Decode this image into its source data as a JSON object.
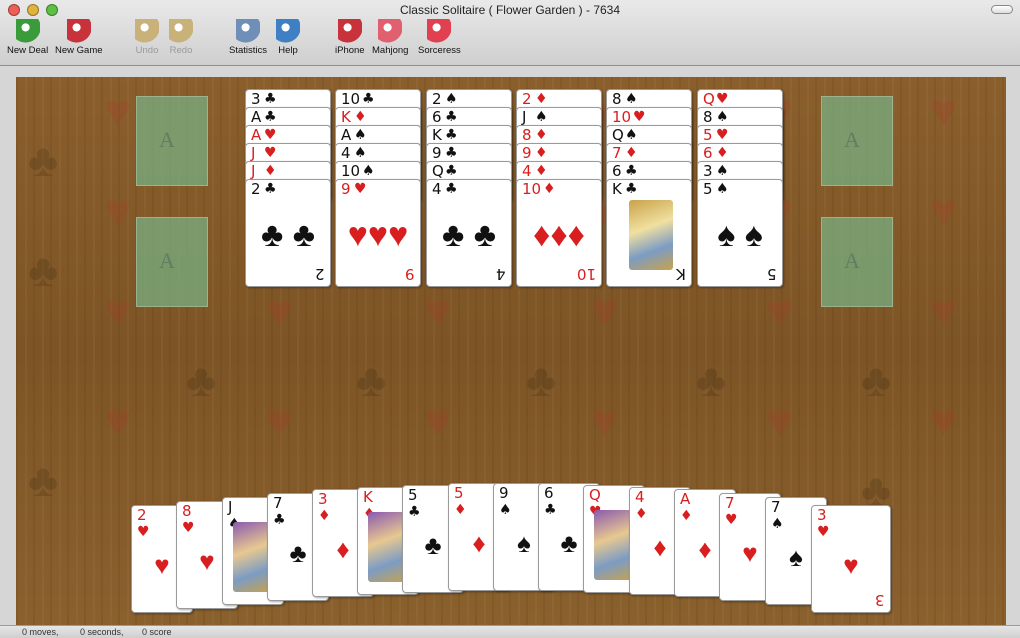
{
  "window": {
    "title": "Classic Solitaire ( Flower Garden ) - 7634"
  },
  "toolbar": [
    {
      "label": "New Deal",
      "icon": "new-deal-icon",
      "enabled": true
    },
    {
      "label": "New Game",
      "icon": "new-game-icon",
      "enabled": true
    },
    {
      "label": "Undo",
      "icon": "undo-icon",
      "enabled": false
    },
    {
      "label": "Redo",
      "icon": "redo-icon",
      "enabled": false
    },
    {
      "label": "Statistics",
      "icon": "statistics-icon",
      "enabled": true
    },
    {
      "label": "Help",
      "icon": "help-icon",
      "enabled": true
    },
    {
      "label": "iPhone",
      "icon": "iphone-icon",
      "enabled": true
    },
    {
      "label": "Mahjong",
      "icon": "mahjong-icon",
      "enabled": true
    },
    {
      "label": "Sorceress",
      "icon": "sorceress-icon",
      "enabled": true
    }
  ],
  "foundations": [
    {
      "label": "A"
    },
    {
      "label": "A"
    },
    {
      "label": "A"
    },
    {
      "label": "A"
    }
  ],
  "tableau": [
    {
      "cards": [
        [
          "3",
          "♣",
          "blk"
        ],
        [
          "A",
          "♣",
          "blk"
        ],
        [
          "A",
          "♥",
          "red"
        ],
        [
          "J",
          "♥",
          "red"
        ],
        [
          "J",
          "♦",
          "red"
        ],
        [
          "2",
          "♣",
          "blk"
        ]
      ],
      "top_big": "♣ ♣",
      "top_bot": "2"
    },
    {
      "cards": [
        [
          "10",
          "♣",
          "blk"
        ],
        [
          "K",
          "♦",
          "red"
        ],
        [
          "A",
          "♠",
          "blk"
        ],
        [
          "4",
          "♠",
          "blk"
        ],
        [
          "10",
          "♠",
          "blk"
        ],
        [
          "9",
          "♥",
          "red"
        ]
      ],
      "top_big": "♥♥♥",
      "top_bot": "9"
    },
    {
      "cards": [
        [
          "2",
          "♠",
          "blk"
        ],
        [
          "6",
          "♣",
          "blk"
        ],
        [
          "K",
          "♣",
          "blk"
        ],
        [
          "9",
          "♣",
          "blk"
        ],
        [
          "Q",
          "♣",
          "blk"
        ],
        [
          "4",
          "♣",
          "blk"
        ]
      ],
      "top_big": "♣ ♣",
      "top_bot": "4"
    },
    {
      "cards": [
        [
          "2",
          "♦",
          "red"
        ],
        [
          "J",
          "♠",
          "blk"
        ],
        [
          "8",
          "♦",
          "red"
        ],
        [
          "9",
          "♦",
          "red"
        ],
        [
          "4",
          "♦",
          "red"
        ],
        [
          "10",
          "♦",
          "red"
        ]
      ],
      "top_big": "♦♦♦",
      "top_bot": "10"
    },
    {
      "cards": [
        [
          "8",
          "♠",
          "blk"
        ],
        [
          "10",
          "♥",
          "red"
        ],
        [
          "Q",
          "♠",
          "blk"
        ],
        [
          "7",
          "♦",
          "red"
        ],
        [
          "6",
          "♣",
          "blk"
        ],
        [
          "K",
          "♣",
          "blk"
        ]
      ],
      "top_big": "",
      "top_bot": "K"
    },
    {
      "cards": [
        [
          "Q",
          "♥",
          "red"
        ],
        [
          "8",
          "♠",
          "blk"
        ],
        [
          "5",
          "♥",
          "red"
        ],
        [
          "6",
          "♦",
          "red"
        ],
        [
          "3",
          "♠",
          "blk"
        ],
        [
          "5",
          "♠",
          "blk"
        ]
      ],
      "top_big": "♠ ♠",
      "top_bot": "5"
    }
  ],
  "hand": [
    [
      "2",
      "♥",
      "red"
    ],
    [
      "8",
      "♥",
      "red"
    ],
    [
      "J",
      "♠",
      "blk"
    ],
    [
      "7",
      "♣",
      "blk"
    ],
    [
      "3",
      "♦",
      "red"
    ],
    [
      "K",
      "♦",
      "red"
    ],
    [
      "5",
      "♣",
      "blk"
    ],
    [
      "5",
      "♦",
      "red"
    ],
    [
      "9",
      "♠",
      "blk"
    ],
    [
      "6",
      "♣",
      "blk"
    ],
    [
      "Q",
      "♥",
      "red"
    ],
    [
      "4",
      "♦",
      "red"
    ],
    [
      "A",
      "♦",
      "red"
    ],
    [
      "7",
      "♥",
      "red"
    ],
    [
      "7",
      "♠",
      "blk"
    ],
    [
      "3",
      "♥",
      "red"
    ]
  ],
  "hand_last_bot": "3",
  "status": {
    "moves": "0 moves,",
    "seconds": "0 seconds,",
    "score": "0 score"
  }
}
